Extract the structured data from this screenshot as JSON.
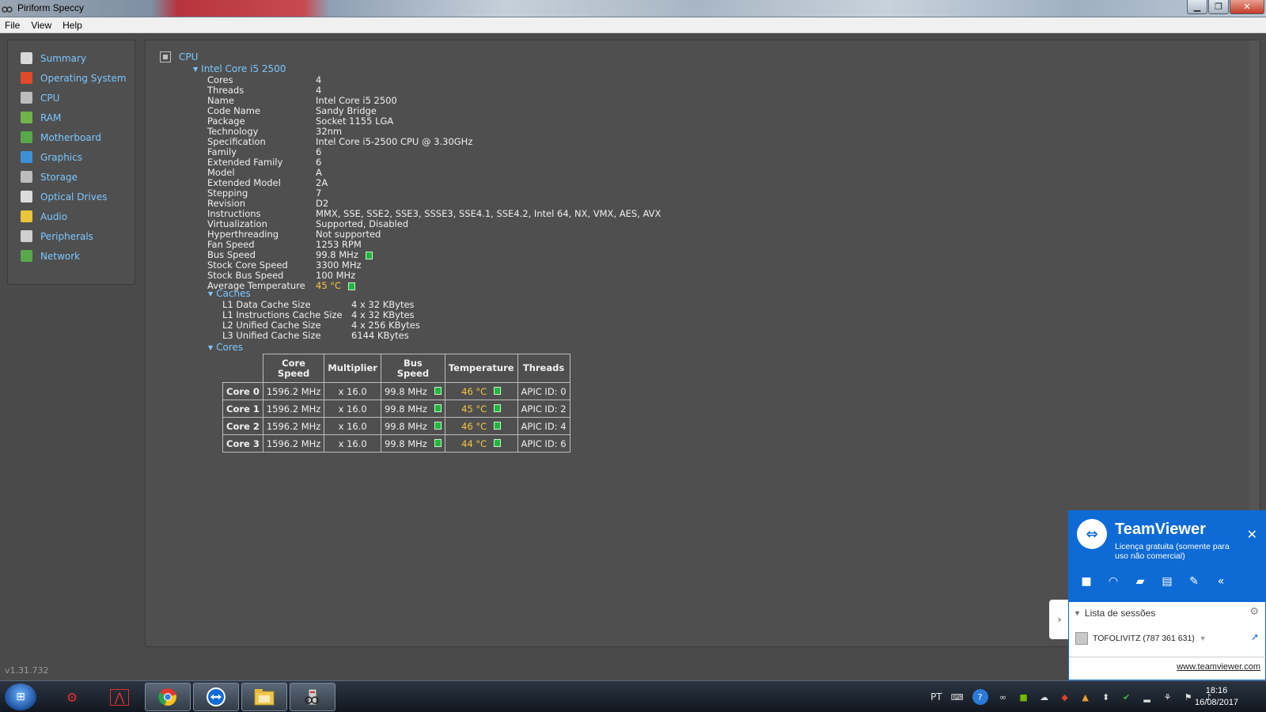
{
  "window": {
    "title": "Piriform Speccy"
  },
  "menu": [
    "File",
    "View",
    "Help"
  ],
  "sidebar": [
    {
      "label": "Summary",
      "icon": "summary-icon",
      "color": "#d9d9d9"
    },
    {
      "label": "Operating System",
      "icon": "windows-icon",
      "color": "#e04a2a"
    },
    {
      "label": "CPU",
      "icon": "cpu-icon",
      "color": "#bdbdbd"
    },
    {
      "label": "RAM",
      "icon": "ram-icon",
      "color": "#6fb34a"
    },
    {
      "label": "Motherboard",
      "icon": "motherboard-icon",
      "color": "#58a84a"
    },
    {
      "label": "Graphics",
      "icon": "monitor-icon",
      "color": "#3d8fd6"
    },
    {
      "label": "Storage",
      "icon": "hard-drive-icon",
      "color": "#bdbdbd"
    },
    {
      "label": "Optical Drives",
      "icon": "disc-icon",
      "color": "#dcdcdc"
    },
    {
      "label": "Audio",
      "icon": "speaker-icon",
      "color": "#e8c53a"
    },
    {
      "label": "Peripherals",
      "icon": "mouse-icon",
      "color": "#d0d0d0"
    },
    {
      "label": "Network",
      "icon": "network-icon",
      "color": "#58a84a"
    }
  ],
  "version": "v1.31.732",
  "cpu": {
    "section": "CPU",
    "model": "Intel Core i5 2500",
    "props": [
      {
        "k": "Cores",
        "v": "4"
      },
      {
        "k": "Threads",
        "v": "4"
      },
      {
        "k": "Name",
        "v": "Intel Core i5 2500"
      },
      {
        "k": "Code Name",
        "v": "Sandy Bridge"
      },
      {
        "k": "Package",
        "v": "Socket 1155 LGA"
      },
      {
        "k": "Technology",
        "v": "32nm"
      },
      {
        "k": "Specification",
        "v": "Intel Core i5-2500 CPU @ 3.30GHz"
      },
      {
        "k": "Family",
        "v": "6"
      },
      {
        "k": "Extended Family",
        "v": "6"
      },
      {
        "k": "Model",
        "v": "A"
      },
      {
        "k": "Extended Model",
        "v": "2A"
      },
      {
        "k": "Stepping",
        "v": "7"
      },
      {
        "k": "Revision",
        "v": "D2"
      },
      {
        "k": "Instructions",
        "v": "MMX, SSE, SSE2, SSE3, SSSE3, SSE4.1, SSE4.2, Intel 64, NX, VMX, AES, AVX"
      },
      {
        "k": "Virtualization",
        "v": "Supported, Disabled"
      },
      {
        "k": "Hyperthreading",
        "v": "Not supported"
      },
      {
        "k": "Fan Speed",
        "v": "1253 RPM"
      },
      {
        "k": "Bus Speed",
        "v": "99.8 MHz",
        "box": true
      },
      {
        "k": "Stock Core Speed",
        "v": "3300 MHz"
      },
      {
        "k": "Stock Bus Speed",
        "v": "100 MHz"
      },
      {
        "k": "Average Temperature",
        "v": "45 °C",
        "hot": true,
        "box": true
      }
    ],
    "caches_label": "Caches",
    "caches": [
      {
        "k": "L1 Data Cache Size",
        "v": "4 x 32 KBytes"
      },
      {
        "k": "L1 Instructions Cache Size",
        "v": "4 x 32 KBytes"
      },
      {
        "k": "L2 Unified Cache Size",
        "v": "4 x 256 KBytes"
      },
      {
        "k": "L3 Unified Cache Size",
        "v": "6144 KBytes"
      }
    ],
    "cores_label": "Cores",
    "cores_headers": [
      "Core\nSpeed",
      "Multiplier",
      "Bus\nSpeed",
      "Temperature",
      "Threads"
    ],
    "cores": [
      {
        "name": "Core 0",
        "speed": "1596.2 MHz",
        "mult": "x 16.0",
        "bus": "99.8 MHz",
        "temp": "46 °C",
        "threads": "APIC ID: 0"
      },
      {
        "name": "Core 1",
        "speed": "1596.2 MHz",
        "mult": "x 16.0",
        "bus": "99.8 MHz",
        "temp": "45 °C",
        "threads": "APIC ID: 2"
      },
      {
        "name": "Core 2",
        "speed": "1596.2 MHz",
        "mult": "x 16.0",
        "bus": "99.8 MHz",
        "temp": "46 °C",
        "threads": "APIC ID: 4"
      },
      {
        "name": "Core 3",
        "speed": "1596.2 MHz",
        "mult": "x 16.0",
        "bus": "99.8 MHz",
        "temp": "44 °C",
        "threads": "APIC ID: 6"
      }
    ]
  },
  "teamviewer": {
    "brand": "TeamViewer",
    "license": "Licença gratuita (somente para uso não comercial)",
    "sessions_label": "Lista de sessões",
    "partner": "TOFOLIVITZ (787 361 631)",
    "link": "www.teamviewer.com"
  },
  "taskbar": {
    "lang": "PT",
    "time": "18:16",
    "date": "16/08/2017"
  }
}
